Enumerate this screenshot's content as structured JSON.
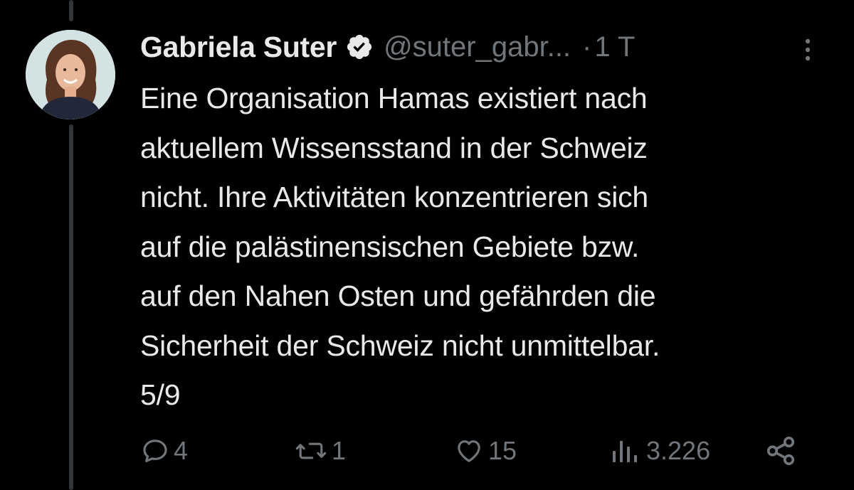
{
  "tweet": {
    "author_name": "Gabriela Suter",
    "handle": "@suter_gabr...",
    "separator": "·",
    "time": "1 T",
    "text_lines": [
      "Eine Organisation Hamas existiert nach",
      "aktuellem Wissensstand in der Schweiz",
      "nicht. Ihre Aktivitäten konzentrieren sich",
      "auf die palästinensischen Gebiete bzw.",
      "auf den Nahen Osten und gefährden die",
      "Sicherheit der Schweiz nicht unmittelbar.",
      "5/9"
    ]
  },
  "actions": {
    "replies": "4",
    "retweets": "1",
    "likes": "15",
    "views": "3.226"
  },
  "icons": {
    "verified": "verified-badge-icon",
    "more": "more-vertical-icon",
    "reply": "reply-bubble-icon",
    "retweet": "retweet-icon",
    "like": "heart-icon",
    "views": "views-bars-icon",
    "share": "share-icon"
  },
  "colors": {
    "background": "#000000",
    "text": "#e7e9ea",
    "muted": "#71767b",
    "thread_line": "#333639"
  }
}
